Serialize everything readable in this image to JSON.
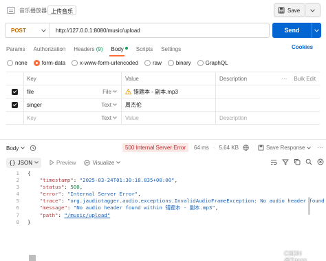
{
  "header": {
    "breadcrumb_parent": "音乐播放器",
    "breadcrumb_sep": "/",
    "breadcrumb_current": "上传音乐",
    "save_label": "Save"
  },
  "request": {
    "method": "POST",
    "url": "http://127.0.0.1:8080/music/upload",
    "send_label": "Send"
  },
  "tabs": [
    {
      "label": "Params"
    },
    {
      "label": "Authorization"
    },
    {
      "label": "Headers",
      "count": "(9)"
    },
    {
      "label": "Body",
      "active": true
    },
    {
      "label": "Scripts"
    },
    {
      "label": "Settings"
    }
  ],
  "cookies_label": "Cookies",
  "body_types": [
    {
      "label": "none",
      "selected": false
    },
    {
      "label": "form-data",
      "selected": true
    },
    {
      "label": "x-www-form-urlencoded",
      "selected": false
    },
    {
      "label": "raw",
      "selected": false
    },
    {
      "label": "binary",
      "selected": false
    },
    {
      "label": "GraphQL",
      "selected": false
    }
  ],
  "form_table": {
    "headers": {
      "key": "Key",
      "value": "Value",
      "description": "Description",
      "bulk_edit": "Bulk Edit"
    },
    "rows": [
      {
        "key": "file",
        "type": "File",
        "value": "错题本 - 副本.mp3",
        "checked": true
      },
      {
        "key": "singer",
        "type": "Text",
        "value": "周杰伦",
        "checked": true
      }
    ],
    "new_row": {
      "key_placeholder": "Key",
      "type": "Text",
      "value_placeholder": "Value",
      "desc_placeholder": "Description"
    }
  },
  "response": {
    "body_label": "Body",
    "status": "500 Internal Server Error",
    "time": "64 ms",
    "size": "5.64 KB",
    "save_response_label": "Save Response",
    "format_label": "JSON",
    "preview_label": "Preview",
    "visualize_label": "Visualize",
    "lines": [
      {
        "n": "1",
        "open": "{"
      },
      {
        "n": "2",
        "key": "\"timestamp\"",
        "val": "\"2025-03-24T01:30:18.835+00:00\"",
        "t": "s"
      },
      {
        "n": "3",
        "key": "\"status\"",
        "val": "500",
        "t": "n"
      },
      {
        "n": "4",
        "key": "\"error\"",
        "val": "\"Internal Server Error\"",
        "t": "s"
      },
      {
        "n": "5",
        "key": "\"trace\"",
        "val": "\"org.jaudiotagger.audio.exceptions.InvalidAudioFrameException: No audio header found wi",
        "t": "s"
      },
      {
        "n": "6",
        "key": "\"message\"",
        "val": "\"No audio header found within 错题本 - 副本.mp3\"",
        "t": "s"
      },
      {
        "n": "7",
        "key": "\"path\"",
        "val": "\"/music/upload\"",
        "t": "l"
      },
      {
        "n": "8",
        "close": "}"
      }
    ]
  },
  "watermark": "CSDN @Tgsss",
  "colors": {
    "accent": "#ff6c37",
    "send": "#0265d2",
    "method": "#c56d00",
    "error": "#c62828"
  }
}
